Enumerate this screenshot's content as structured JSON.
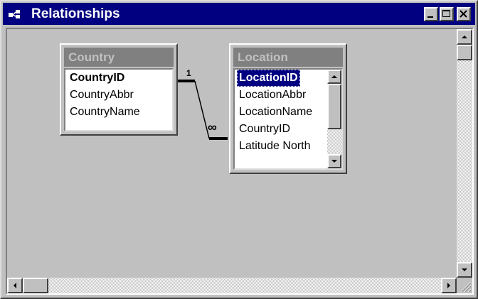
{
  "window": {
    "title": "Relationships",
    "icons": {
      "app": "relationships-icon",
      "minimize": "minimize-icon",
      "maximize": "maximize-icon",
      "close": "close-icon"
    }
  },
  "tables": {
    "country": {
      "name": "Country",
      "fields": [
        "CountryID",
        "CountryAbbr",
        "CountryName"
      ],
      "primary_key": "CountryID"
    },
    "location": {
      "name": "Location",
      "fields": [
        "LocationID",
        "LocationAbbr",
        "LocationName",
        "CountryID",
        "Latitude North"
      ],
      "primary_key": "LocationID",
      "selected": "LocationID"
    }
  },
  "relationship": {
    "from": "Country.CountryID",
    "to": "Location.CountryID",
    "one_label": "1",
    "many_label": "∞"
  },
  "colors": {
    "titlebar": "#000080",
    "face": "#c0c0c0",
    "selection": "#000080",
    "table_header": "#808080"
  }
}
